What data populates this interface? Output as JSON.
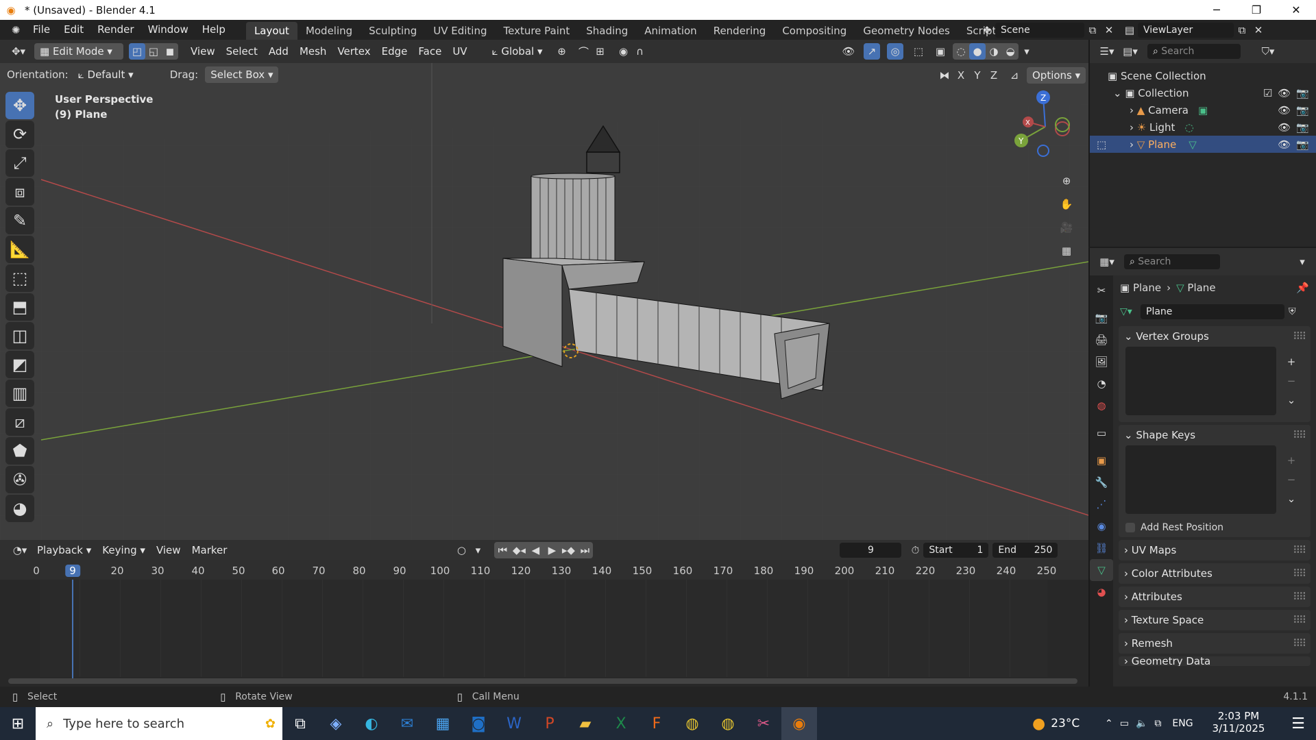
{
  "window": {
    "title": "* (Unsaved) - Blender 4.1",
    "minimize": "─",
    "maximize": "❐",
    "close": "✕"
  },
  "menu": [
    "File",
    "Edit",
    "Render",
    "Window",
    "Help"
  ],
  "workspaces": [
    "Layout",
    "Modeling",
    "Sculpting",
    "UV Editing",
    "Texture Paint",
    "Shading",
    "Animation",
    "Rendering",
    "Compositing",
    "Geometry Nodes",
    "Scripting"
  ],
  "scene": {
    "name": "Scene",
    "view_layer": "ViewLayer"
  },
  "header": {
    "mode": "Edit Mode",
    "menus": [
      "View",
      "Select",
      "Add",
      "Mesh",
      "Vertex",
      "Edge",
      "Face",
      "UV"
    ],
    "transform": "Global",
    "orientation_label": "Orientation:",
    "orientation": "Default",
    "drag_label": "Drag:",
    "drag": "Select Box",
    "axes": [
      "X",
      "Y",
      "Z"
    ],
    "options": "Options"
  },
  "viewport": {
    "perspective": "User Perspective",
    "object": "(9) Plane",
    "gizmo": {
      "z": "Z",
      "y": "Y",
      "x": "X"
    }
  },
  "timeline": {
    "menus": [
      "Playback",
      "Keying",
      "View",
      "Marker"
    ],
    "current_frame": "9",
    "start_label": "Start",
    "start": "1",
    "end_label": "End",
    "end": "250",
    "ticks": [
      "0",
      "9",
      "20",
      "30",
      "40",
      "50",
      "60",
      "70",
      "80",
      "90",
      "100",
      "110",
      "120",
      "130",
      "140",
      "150",
      "160",
      "170",
      "180",
      "190",
      "200",
      "210",
      "220",
      "230",
      "240",
      "250"
    ]
  },
  "status": {
    "select": "Select",
    "rotate": "Rotate View",
    "menu": "Call Menu",
    "version": "4.1.1"
  },
  "outliner": {
    "search_placeholder": "Search",
    "root": "Scene Collection",
    "collection": "Collection",
    "items": [
      {
        "label": "Camera"
      },
      {
        "label": "Light"
      },
      {
        "label": "Plane"
      }
    ]
  },
  "properties": {
    "search_placeholder": "Search",
    "breadcrumb": [
      "Plane",
      "Plane"
    ],
    "mesh_name": "Plane",
    "panels": {
      "vertex_groups": "Vertex Groups",
      "shape_keys": "Shape Keys",
      "add_rest_position": "Add Rest Position",
      "collapsed": [
        "UV Maps",
        "Color Attributes",
        "Attributes",
        "Texture Space",
        "Remesh"
      ],
      "cut_off": "Geometry Data"
    }
  },
  "taskbar": {
    "search_placeholder": "Type here to search",
    "weather": "23°C",
    "lang": "ENG",
    "time": "2:03 PM",
    "date": "3/11/2025"
  },
  "colors": {
    "accent": "#4772b3",
    "selected_row": "#334d80",
    "viewport": "#3d3d3d",
    "axis_x": "#b34a4a",
    "axis_y": "#7aa33b",
    "axis_z": "#3b6fd6"
  }
}
